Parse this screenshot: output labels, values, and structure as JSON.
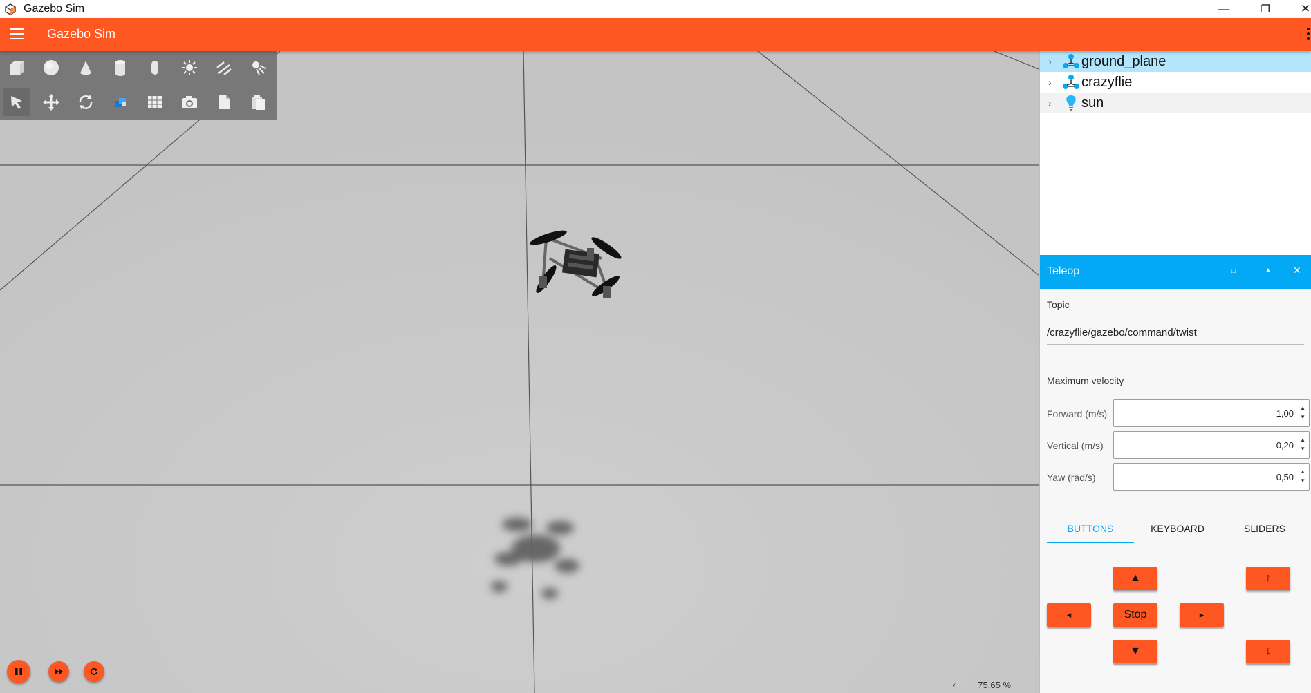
{
  "window": {
    "title": "Gazebo Sim",
    "minimize_glyph": "—",
    "restore_glyph": "❐",
    "close_glyph": "✕"
  },
  "appbar": {
    "title": "Gazebo Sim",
    "menu_icon": "hamburger-icon",
    "overflow_icon": "kebab-icon",
    "color": "#ff5722"
  },
  "toolbar": {
    "row1": [
      "box-icon",
      "sphere-icon",
      "cone-icon",
      "cylinder-icon",
      "capsule-icon",
      "sun-light-icon",
      "directional-light-icon",
      "spot-light-icon"
    ],
    "row2": [
      "select-arrow-icon",
      "translate-icon",
      "rotate-icon",
      "lights-icon",
      "grid-icon",
      "camera-icon",
      "copy-icon",
      "paste-icon"
    ]
  },
  "playback": {
    "pause_icon": "pause-icon",
    "step_icon": "fast-forward-icon",
    "reset_icon": "reset-icon"
  },
  "rtf": {
    "collapse_glyph": "‹",
    "value": "75.65 %"
  },
  "entity_tree": {
    "items": [
      {
        "label": "ground_plane",
        "icon": "model-icon",
        "selected": true
      },
      {
        "label": "crazyflie",
        "icon": "model-icon",
        "selected": false
      },
      {
        "label": "sun",
        "icon": "light-bulb-icon",
        "selected": false
      }
    ]
  },
  "teleop": {
    "title": "Teleop",
    "header_color": "#03a9f4",
    "topic_label": "Topic",
    "topic_value": "/crazyflie/gazebo/command/twist",
    "max_velocity_label": "Maximum velocity",
    "fields": [
      {
        "label": "Forward (m/s)",
        "value": "1,00"
      },
      {
        "label": "Vertical (m/s)",
        "value": "0,20"
      },
      {
        "label": "Yaw (rad/s)",
        "value": "0,50"
      }
    ],
    "tabs": [
      "BUTTONS",
      "KEYBOARD",
      "SLIDERS"
    ],
    "active_tab": "BUTTONS",
    "buttons": {
      "forward": "▲",
      "backward": "▼",
      "left": "◂",
      "right": "▸",
      "stop": "Stop",
      "up": "↑",
      "down": "↓"
    }
  }
}
